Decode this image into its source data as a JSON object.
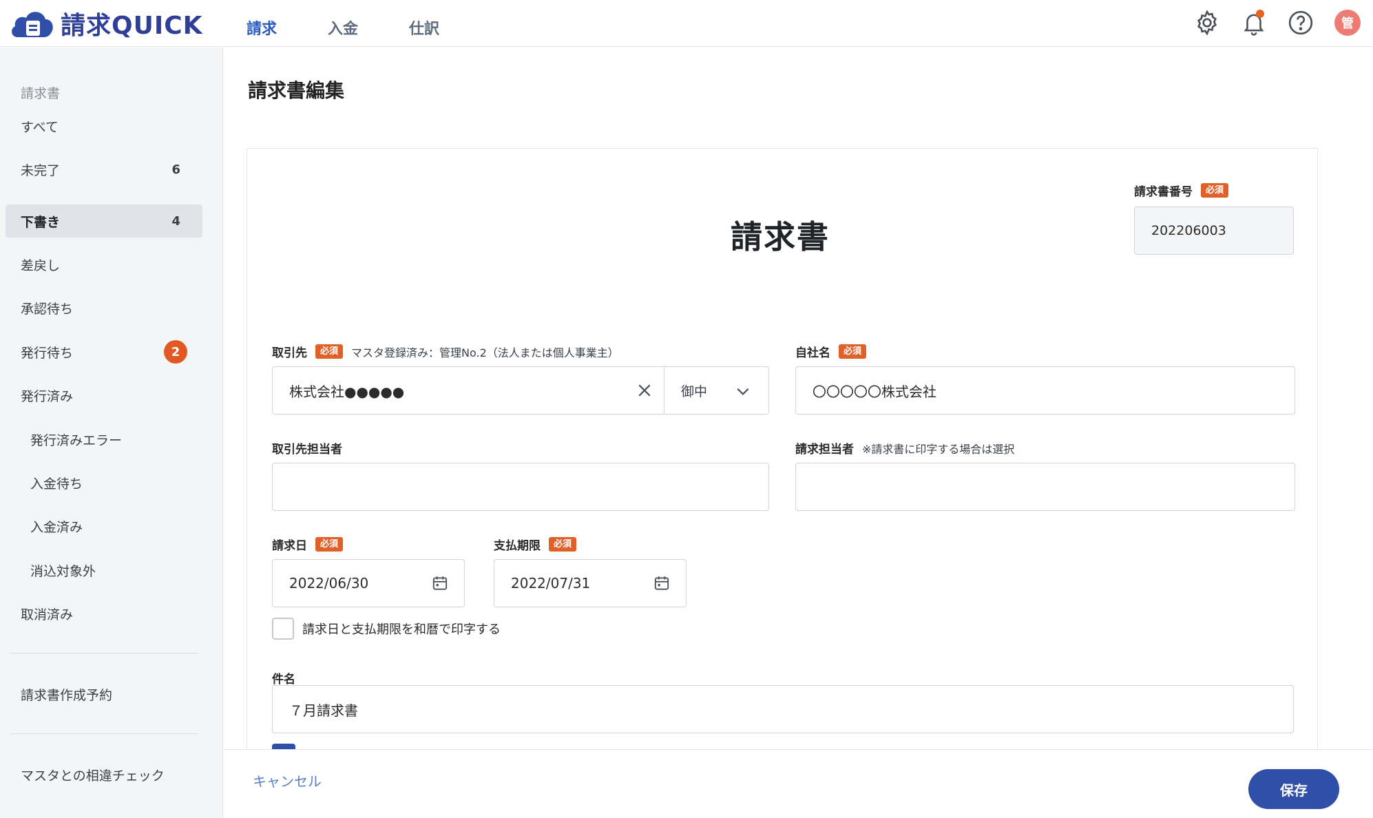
{
  "app": {
    "title": "請求QUICK"
  },
  "nav": {
    "tabs": [
      {
        "label": "請求"
      },
      {
        "label": "入金"
      },
      {
        "label": "仕訳"
      }
    ]
  },
  "header": {
    "avatar_label": "管"
  },
  "sidebar": {
    "section_label": "請求書",
    "items": [
      {
        "label": "すべて"
      },
      {
        "label": "未完了",
        "count": "6"
      },
      {
        "label": "下書き",
        "count": "4"
      },
      {
        "label": "差戻し"
      },
      {
        "label": "承認待ち"
      },
      {
        "label": "発行待ち",
        "badge": "2"
      },
      {
        "label": "発行済み"
      },
      {
        "label": "発行済みエラー"
      },
      {
        "label": "入金待ち"
      },
      {
        "label": "入金済み"
      },
      {
        "label": "消込対象外"
      },
      {
        "label": "取消済み"
      }
    ],
    "reservation": "請求書作成予約",
    "master_check": "マスタとの相違チェック"
  },
  "main": {
    "page_title": "請求書編集",
    "doc_title": "請求書",
    "required_tag": "必須",
    "invoice_number": {
      "label": "請求書番号",
      "value": "202206003"
    },
    "client": {
      "label": "取引先",
      "note": "マスタ登録済み：管理No.2（法人または個人事業主）",
      "value": "株式会社●●●●●",
      "honorific": "御中"
    },
    "company": {
      "label": "自社名",
      "value": "〇〇〇〇〇株式会社"
    },
    "client_contact": {
      "label": "取引先担当者",
      "value": ""
    },
    "billing_contact": {
      "label": "請求担当者",
      "note": "※請求書に印字する場合は選択",
      "value": ""
    },
    "billing_date": {
      "label": "請求日",
      "value": "2022/06/30"
    },
    "due_date": {
      "label": "支払期限",
      "value": "2022/07/31"
    },
    "wareki_checkbox": {
      "label": "請求日と支払期限を和暦で印字する"
    },
    "subject": {
      "label": "件名",
      "value": "７月請求書"
    }
  },
  "footer": {
    "cancel": "キャンセル",
    "save": "保存"
  },
  "colors": {
    "brand": "#2f4fa8",
    "required": "#e0602a",
    "badge": "#e25822",
    "link": "#5b7fc4"
  },
  "icons": [
    "cloud-logo-icon",
    "gear-icon",
    "bell-icon",
    "help-icon",
    "close-icon",
    "chevron-down-icon",
    "calendar-icon"
  ]
}
